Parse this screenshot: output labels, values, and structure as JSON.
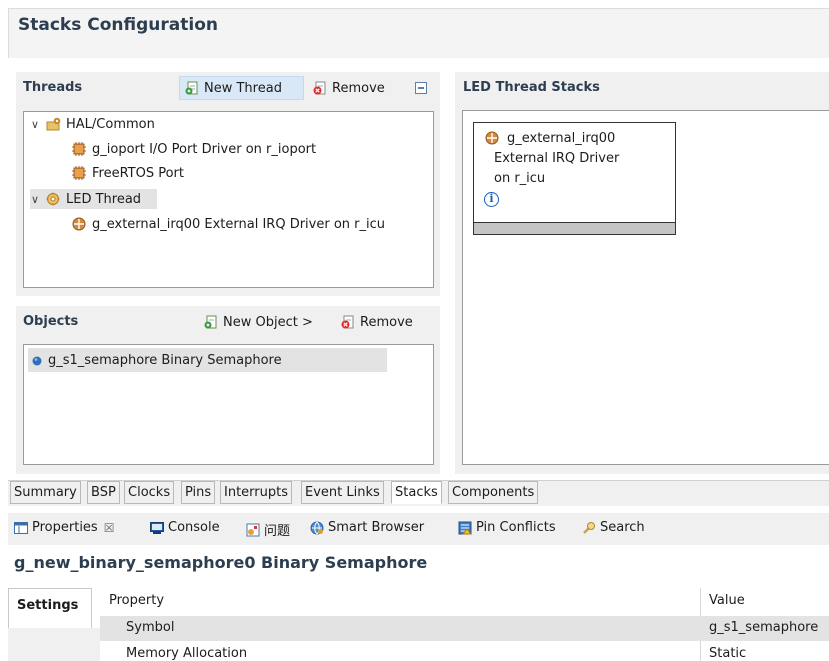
{
  "stacks_config": {
    "title": "Stacks Configuration"
  },
  "threads": {
    "header": "Threads",
    "new_thread_label": "New Thread",
    "remove_label": "Remove",
    "tree": [
      {
        "label": "HAL/Common"
      },
      {
        "label": "g_ioport I/O Port Driver on r_ioport"
      },
      {
        "label": "FreeRTOS Port"
      },
      {
        "label": "LED Thread"
      },
      {
        "label": "g_external_irq00 External IRQ Driver on r_icu"
      }
    ]
  },
  "objects": {
    "header": "Objects",
    "new_object_label": "New Object >",
    "remove_label": "Remove",
    "items": [
      {
        "label": "g_s1_semaphore Binary Semaphore"
      }
    ]
  },
  "led_stacks": {
    "header": "LED Thread Stacks",
    "module_lines": [
      "g_external_irq00",
      "External IRQ Driver",
      "on r_icu"
    ],
    "info_glyph": "i"
  },
  "editor_tabs": [
    "Summary",
    "BSP",
    "Clocks",
    "Pins",
    "Interrupts",
    "Event Links",
    "Stacks",
    "Components"
  ],
  "active_tab": "Stacks",
  "views": {
    "properties_label": "Properties",
    "close_glyph": "☒",
    "console_label": "Console",
    "problems_label": "问题",
    "smart_browser_label": "Smart Browser",
    "pin_conflicts_label": "Pin Conflicts",
    "search_label": "Search"
  },
  "properties": {
    "title": "g_new_binary_semaphore0 Binary Semaphore",
    "settings_tab": "Settings",
    "col_property": "Property",
    "col_value": "Value",
    "rows": [
      {
        "property": "Symbol",
        "value": "g_s1_semaphore"
      },
      {
        "property": "Memory Allocation",
        "value": "Static"
      }
    ]
  },
  "colors": {
    "accent_blue": "#1a5fb4",
    "title_navy": "#2c3e50",
    "selection_gray": "#e3e3e3"
  },
  "icons": {
    "new": "new-thread-icon",
    "remove": "remove-icon",
    "collapse": "collapse-icon",
    "hal": "hal-folder-icon",
    "driver": "driver-icon",
    "thread": "thread-icon",
    "semaphore": "semaphore-icon",
    "info": "info-icon"
  }
}
